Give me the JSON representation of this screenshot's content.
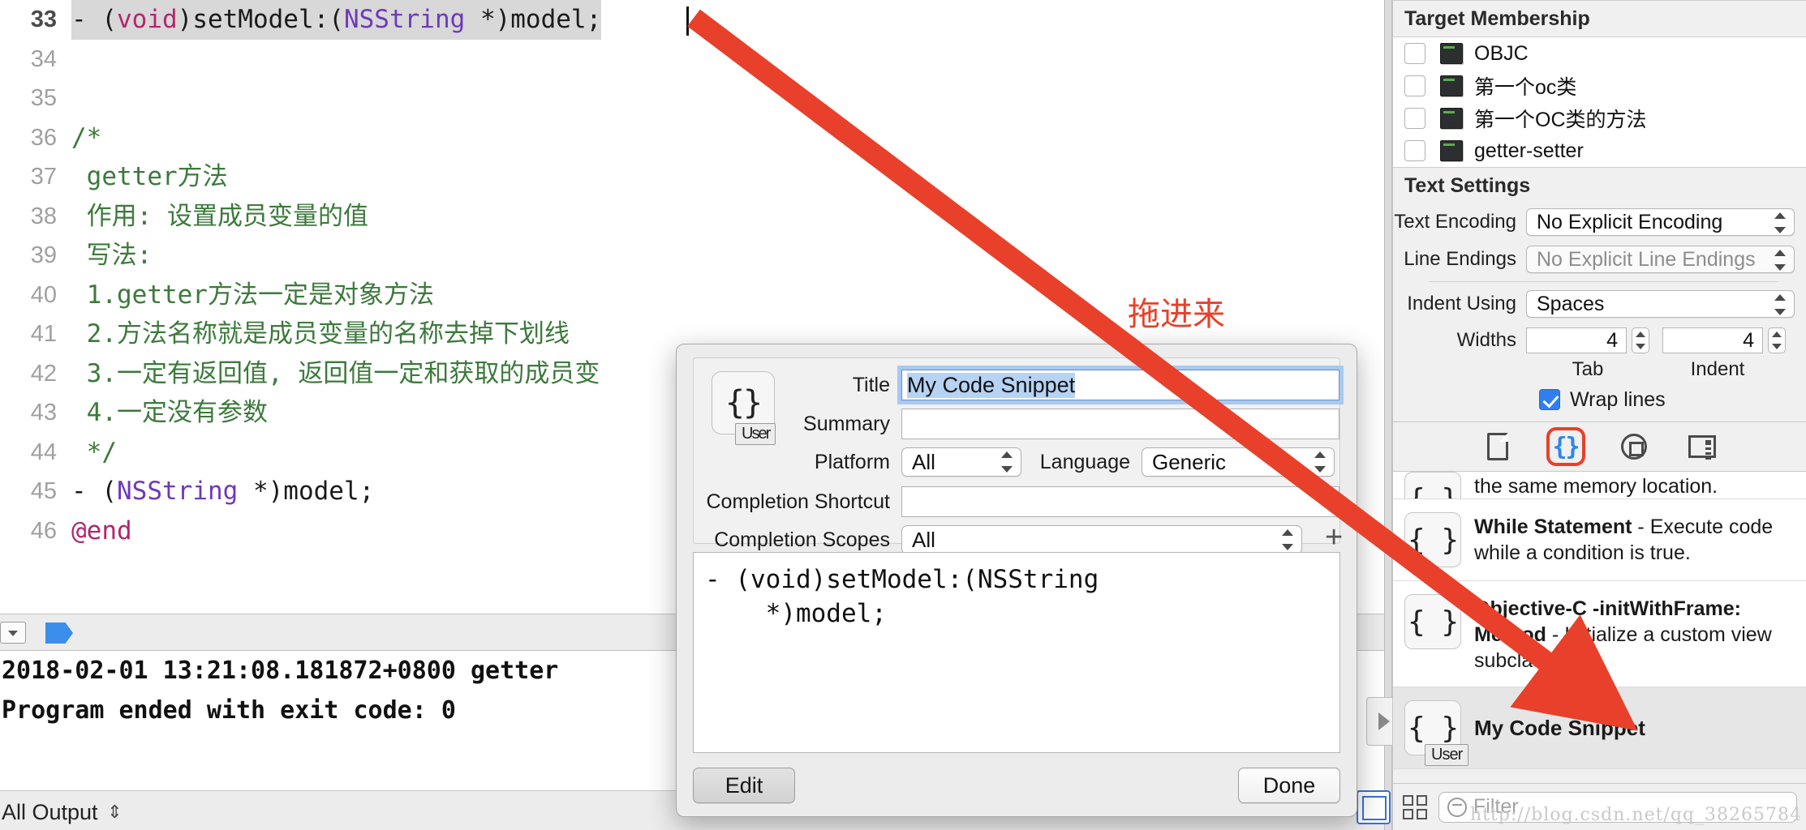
{
  "editor": {
    "lines": [
      {
        "num": "33",
        "highlight": true,
        "segments": [
          {
            "t": "- (",
            "c": "plain"
          },
          {
            "t": "void",
            "c": "kw"
          },
          {
            "t": ")setModel:(",
            "c": "plain"
          },
          {
            "t": "NSString",
            "c": "type"
          },
          {
            "t": " *)model;",
            "c": "plain"
          }
        ]
      },
      {
        "num": "34",
        "highlight": false,
        "segments": []
      },
      {
        "num": "35",
        "highlight": false,
        "segments": []
      },
      {
        "num": "36",
        "highlight": false,
        "segments": [
          {
            "t": "/*",
            "c": "cmt"
          }
        ]
      },
      {
        "num": "37",
        "highlight": false,
        "segments": [
          {
            "t": " getter方法",
            "c": "cmt"
          }
        ]
      },
      {
        "num": "38",
        "highlight": false,
        "segments": [
          {
            "t": " 作用: 设置成员变量的值",
            "c": "cmt"
          }
        ]
      },
      {
        "num": "39",
        "highlight": false,
        "segments": [
          {
            "t": " 写法:",
            "c": "cmt"
          }
        ]
      },
      {
        "num": "40",
        "highlight": false,
        "segments": [
          {
            "t": " 1.getter方法一定是对象方法",
            "c": "cmt"
          }
        ]
      },
      {
        "num": "41",
        "highlight": false,
        "segments": [
          {
            "t": " 2.方法名称就是成员变量的名称去掉下划线",
            "c": "cmt"
          }
        ]
      },
      {
        "num": "42",
        "highlight": false,
        "segments": [
          {
            "t": " 3.一定有返回值, 返回值一定和获取的成员变",
            "c": "cmt"
          }
        ]
      },
      {
        "num": "43",
        "highlight": false,
        "segments": [
          {
            "t": " 4.一定没有参数",
            "c": "cmt"
          }
        ]
      },
      {
        "num": "44",
        "highlight": false,
        "segments": [
          {
            "t": " */",
            "c": "cmt"
          }
        ]
      },
      {
        "num": "45",
        "highlight": false,
        "segments": [
          {
            "t": "- (",
            "c": "plain"
          },
          {
            "t": "NSString",
            "c": "type"
          },
          {
            "t": " *)model;",
            "c": "plain"
          }
        ]
      },
      {
        "num": "46",
        "highlight": false,
        "segments": [
          {
            "t": "@end",
            "c": "kw"
          }
        ]
      }
    ]
  },
  "console": {
    "line1": "2018-02-01 13:21:08.181872+0800 getter",
    "line2": "Program ended with exit code: 0",
    "filter_label": "All Output"
  },
  "inspector": {
    "target_membership": {
      "title": "Target Membership",
      "items": [
        {
          "label": "OBJC",
          "checked": false
        },
        {
          "label": "第一个oc类",
          "checked": false
        },
        {
          "label": "第一个OC类的方法",
          "checked": false
        },
        {
          "label": "getter-setter",
          "checked": false
        }
      ]
    },
    "text_settings": {
      "title": "Text Settings",
      "text_encoding_label": "Text Encoding",
      "text_encoding_value": "No Explicit Encoding",
      "line_endings_label": "Line Endings",
      "line_endings_value": "No Explicit Line Endings",
      "indent_using_label": "Indent Using",
      "indent_using_value": "Spaces",
      "widths_label": "Widths",
      "tab_width": "4",
      "indent_width": "4",
      "tab_caption": "Tab",
      "indent_caption": "Indent",
      "wrap_lines_label": "Wrap lines",
      "wrap_lines_checked": true
    },
    "library_tabs": [
      {
        "icon": "file-template-icon",
        "selected": false
      },
      {
        "icon": "code-snippet-icon",
        "selected": true
      },
      {
        "icon": "object-library-icon",
        "selected": false
      },
      {
        "icon": "media-library-icon",
        "selected": false
      }
    ],
    "snippets": [
      {
        "clipped": true,
        "title": "",
        "desc": "the same memory location.",
        "selected": false,
        "user": false
      },
      {
        "clipped": false,
        "title": "While Statement",
        "desc": " - Execute code while a condition is true.",
        "selected": false,
        "user": false
      },
      {
        "clipped": false,
        "title": "Objective-C -initWithFrame: Method",
        "desc": " - Initialize a custom view subclass.",
        "selected": false,
        "user": false
      },
      {
        "clipped": false,
        "title": "My Code Snippet",
        "desc": "",
        "selected": true,
        "user": true
      }
    ],
    "filter_placeholder": "Filter",
    "watermark": "http://blog.csdn.net/qq_38265784"
  },
  "popover": {
    "title_label": "Title",
    "title_value": "My Code Snippet",
    "summary_label": "Summary",
    "summary_value": "",
    "platform_label": "Platform",
    "platform_value": "All",
    "language_label": "Language",
    "language_value": "Generic",
    "completion_shortcut_label": "Completion Shortcut",
    "completion_shortcut_value": "",
    "completion_scopes_label": "Completion Scopes",
    "completion_scopes_value": "All",
    "add_scope_label": "+",
    "user_badge": "User",
    "icon_glyph": "{}",
    "code_line1": "- (void)setModel:(NSString",
    "code_line2": "    *)model;",
    "edit_button": "Edit",
    "done_button": "Done"
  },
  "annotation": {
    "drag_here_text": "拖进来",
    "arrow_color": "#e8402a"
  }
}
